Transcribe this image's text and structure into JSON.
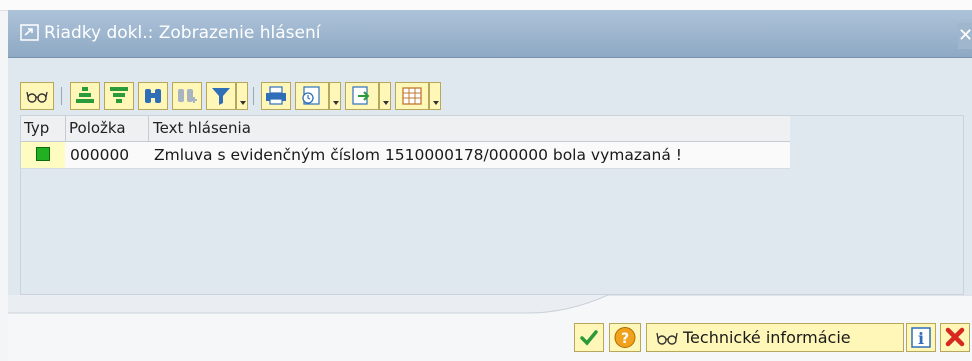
{
  "window": {
    "title": "Riadky dokl.: Zobrazenie hlásení",
    "close_label": "✕"
  },
  "toolbar": {
    "buttons": [
      {
        "name": "glasses-icon"
      },
      {
        "name": "sort-ascending-icon"
      },
      {
        "name": "sort-descending-icon"
      },
      {
        "name": "binoculars-icon"
      },
      {
        "name": "find-next-icon"
      },
      {
        "name": "filter-icon"
      },
      {
        "name": "print-icon"
      },
      {
        "name": "views-icon"
      },
      {
        "name": "export-icon"
      },
      {
        "name": "layout-icon"
      }
    ]
  },
  "grid": {
    "headers": [
      "Typ",
      "Položka",
      "Text hlásenia"
    ],
    "rows": [
      {
        "type": "success",
        "item": "000000",
        "text": "Zmluva s evidenčným číslom 1510000178/000000 bola vymazaná !"
      }
    ]
  },
  "footer": {
    "technical_info_label": "Technické informácie"
  },
  "colors": {
    "titlebar": "#9db5cd",
    "button_bg": "#fff7b8",
    "success": "#21b021",
    "cancel": "#d8281e"
  }
}
